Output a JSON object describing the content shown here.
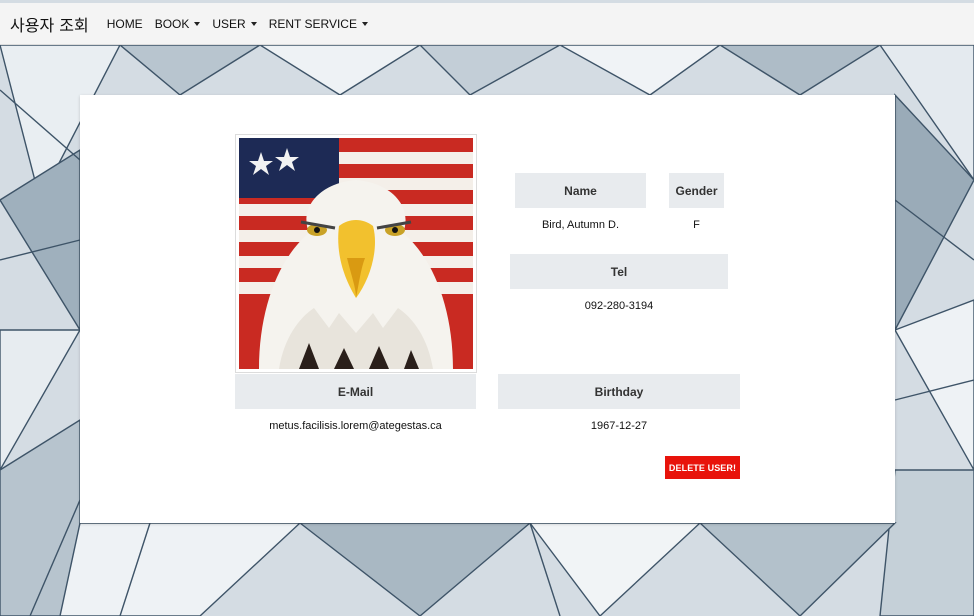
{
  "navbar": {
    "brand": "사용자 조회",
    "items": [
      {
        "label": "HOME",
        "dropdown": false
      },
      {
        "label": "BOOK",
        "dropdown": true
      },
      {
        "label": "USER",
        "dropdown": true
      },
      {
        "label": "RENT SERVICE",
        "dropdown": true
      }
    ]
  },
  "user": {
    "name_header": "Name",
    "name": "Bird, Autumn D.",
    "gender_header": "Gender",
    "gender": "F",
    "tel_header": "Tel",
    "tel": "092-280-3194",
    "email_header": "E-Mail",
    "email": "metus.facilisis.lorem@ategestas.ca",
    "birthday_header": "Birthday",
    "birthday": "1967-12-27",
    "photo_icon": "bald-eagle-flag-photo"
  },
  "actions": {
    "delete_label": "DELETE USER!"
  },
  "colors": {
    "delete_button": "#e8130b",
    "header_cell": "#e8ebee",
    "navbar": "#f4f4f4"
  }
}
